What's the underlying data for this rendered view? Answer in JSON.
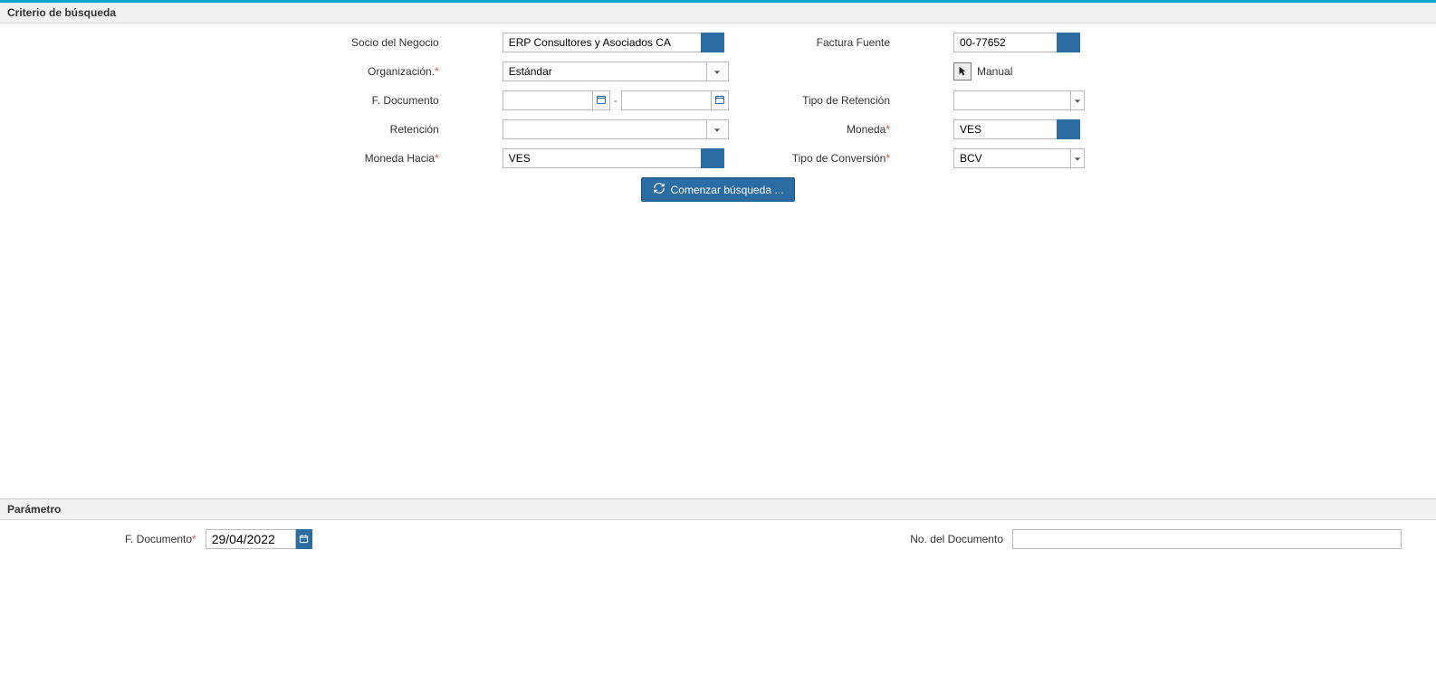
{
  "sections": {
    "search_criteria_title": "Criterio de búsqueda",
    "parametro_title": "Parámetro"
  },
  "labels": {
    "socio_negocio": "Socio del Negocio",
    "factura_fuente": "Factura Fuente",
    "organizacion": "Organización.",
    "manual": "Manual",
    "f_documento": "F. Documento",
    "tipo_retencion": "Tipo de Retención",
    "retencion": "Retención",
    "moneda": "Moneda",
    "moneda_hacia": "Moneda Hacia",
    "tipo_conversion": "Tipo de Conversión",
    "no_documento": "No. del Documento",
    "f_documento_param": "F. Documento"
  },
  "values": {
    "socio_negocio": "ERP Consultores y Asociados CA",
    "factura_fuente": "00-77652",
    "organizacion": "Estándar",
    "f_doc_from": "",
    "f_doc_to": "",
    "tipo_retencion": "",
    "retencion": "",
    "moneda": "VES",
    "moneda_hacia": "VES",
    "tipo_conversion": "BCV",
    "param_f_documento": "29/04/2022",
    "param_no_documento": ""
  },
  "actions": {
    "start_search": "Comenzar búsqueda ..."
  },
  "symbols": {
    "dash": "-"
  },
  "icons": {
    "at": "at-icon",
    "enter": "enter-arrow-icon",
    "calendar": "calendar-icon",
    "caret": "caret-down-icon",
    "refresh": "refresh-icon"
  }
}
